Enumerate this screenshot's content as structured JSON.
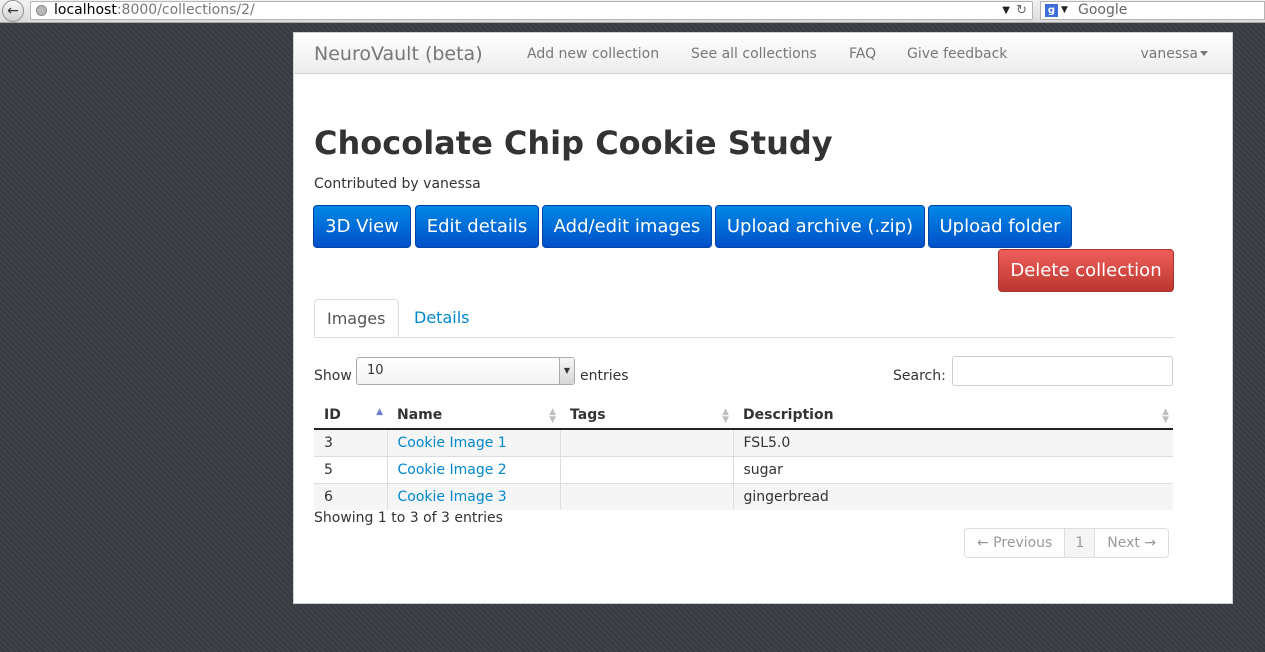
{
  "browser": {
    "url_host": "localhost",
    "url_rest": ":8000/collections/2/",
    "search_engine": "Google"
  },
  "navbar": {
    "brand": "NeuroVault (beta)",
    "links": [
      "Add new collection",
      "See all collections",
      "FAQ",
      "Give feedback"
    ],
    "user": "vanessa"
  },
  "collection": {
    "title": "Chocolate Chip Cookie Study",
    "byline": "Contributed by vanessa"
  },
  "actions": {
    "view3d": "3D View",
    "edit_details": "Edit details",
    "add_edit_images": "Add/edit images",
    "upload_archive": "Upload archive (.zip)",
    "upload_folder": "Upload folder",
    "delete": "Delete collection"
  },
  "tabs": [
    "Images",
    "Details"
  ],
  "table_controls": {
    "show_label": "Show",
    "page_size": "10",
    "entries_label": "entries",
    "search_label": "Search:",
    "search_value": ""
  },
  "table": {
    "columns": [
      "ID",
      "Name",
      "Tags",
      "Description"
    ],
    "rows": [
      {
        "id": "3",
        "name": "Cookie Image 1",
        "tags": "",
        "description": "FSL5.0"
      },
      {
        "id": "5",
        "name": "Cookie Image 2",
        "tags": "",
        "description": "sugar"
      },
      {
        "id": "6",
        "name": "Cookie Image 3",
        "tags": "",
        "description": "gingerbread"
      }
    ]
  },
  "footer": {
    "info": "Showing 1 to 3 of 3 entries",
    "prev": "← Previous",
    "page": "1",
    "next": "Next →"
  },
  "colors": {
    "primary": "#006dcc",
    "danger": "#da4f49",
    "link": "#0088cc"
  }
}
